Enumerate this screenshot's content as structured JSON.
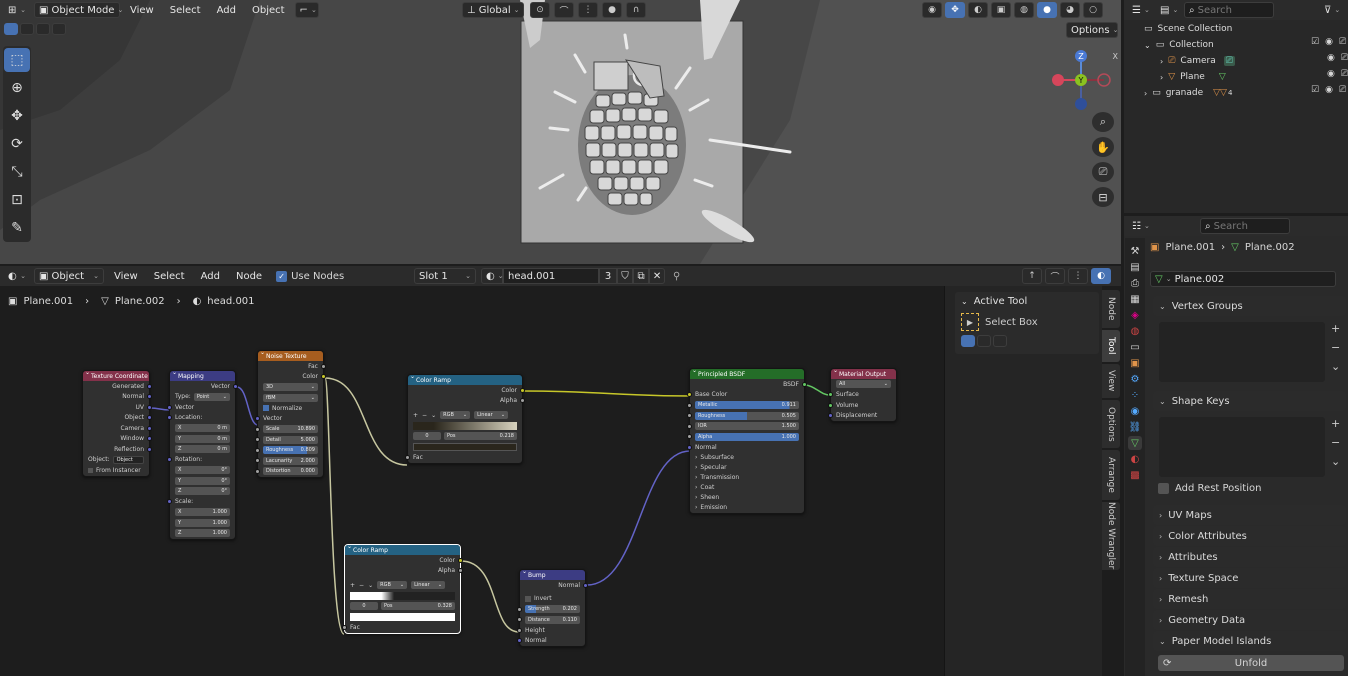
{
  "viewport": {
    "mode": "Object Mode",
    "menus": [
      "View",
      "Select",
      "Add",
      "Object"
    ],
    "orientation": "Global",
    "options": "Options",
    "axis_x": "X",
    "axis_y": "Y",
    "axis_z": "Z"
  },
  "node_editor": {
    "editor": "Object",
    "menus": [
      "View",
      "Select",
      "Add",
      "Node"
    ],
    "use_nodes": "Use Nodes",
    "slot": "Slot 1",
    "material": "head.001",
    "users": "3",
    "breadcrumb": [
      "Plane.001",
      "Plane.002",
      "head.001"
    ],
    "tabs": [
      "Node",
      "Tool",
      "View",
      "Options",
      "Arrange",
      "Node Wrangler"
    ],
    "active_tool": {
      "title": "Active Tool",
      "tool": "Select Box"
    },
    "nodes": {
      "texcoord": {
        "title": "Texture Coordinate",
        "outputs": [
          "Generated",
          "Normal",
          "UV",
          "Object",
          "Camera",
          "Window",
          "Reflection"
        ],
        "object_label": "Object:",
        "object_ph": "Object",
        "instancer": "From Instancer"
      },
      "mapping": {
        "title": "Mapping",
        "out": "Vector",
        "type_label": "Type:",
        "type": "Point",
        "in": "Vector",
        "location": "Location:",
        "rotation": "Rotation:",
        "scale": "Scale:",
        "x": "X",
        "y": "Y",
        "z": "Z",
        "loc": [
          "0 m",
          "0 m",
          "0 m"
        ],
        "rot": [
          "0°",
          "0°",
          "0°"
        ],
        "scl": [
          "1.000",
          "1.000",
          "1.000"
        ]
      },
      "noise": {
        "title": "Noise Texture",
        "fac": "Fac",
        "color": "Color",
        "dim": "3D",
        "basis": "fBM",
        "normalize": "Normalize",
        "vector": "Vector",
        "fields": [
          [
            "Scale",
            "10.890"
          ],
          [
            "Detail",
            "5.000"
          ],
          [
            "Roughness",
            "0.809"
          ],
          [
            "Lacunarity",
            "2.000"
          ],
          [
            "Distortion",
            "0.000"
          ]
        ]
      },
      "ramp1": {
        "title": "Color Ramp",
        "color": "Color",
        "alpha": "Alpha",
        "mode": "RGB",
        "interp": "Linear",
        "index": "0",
        "pos_label": "Pos",
        "pos": "0.218",
        "fac": "Fac"
      },
      "ramp2": {
        "title": "Color Ramp",
        "color": "Color",
        "alpha": "Alpha",
        "mode": "RGB",
        "interp": "Linear",
        "index": "0",
        "pos_label": "Pos",
        "pos": "0.328",
        "fac": "Fac"
      },
      "bump": {
        "title": "Bump",
        "normal_out": "Normal",
        "invert": "Invert",
        "strength_l": "Strength",
        "strength": "0.202",
        "distance_l": "Distance",
        "distance": "0.110",
        "height": "Height",
        "normal_in": "Normal"
      },
      "bsdf": {
        "title": "Principled BSDF",
        "out": "BSDF",
        "base": "Base Color",
        "fields": [
          [
            "Metallic",
            "0.911"
          ],
          [
            "Roughness",
            "0.505"
          ],
          [
            "IOR",
            "1.500"
          ],
          [
            "Alpha",
            "1.000"
          ]
        ],
        "normal": "Normal",
        "panels": [
          "Subsurface",
          "Specular",
          "Transmission",
          "Coat",
          "Sheen",
          "Emission"
        ]
      },
      "output": {
        "title": "Material Output",
        "target": "All",
        "inputs": [
          "Surface",
          "Volume",
          "Displacement"
        ]
      }
    }
  },
  "outliner": {
    "search": "Search",
    "scene": "Scene Collection",
    "collection": "Collection",
    "camera": "Camera",
    "plane": "Plane",
    "granade": "granade",
    "count": "4"
  },
  "properties": {
    "search": "Search",
    "obj": "Plane.001",
    "mesh": "Plane.002",
    "mesh_field": "Plane.002",
    "panels": [
      "Vertex Groups",
      "Shape Keys"
    ],
    "add_rest": "Add Rest Position",
    "collapsed": [
      "UV Maps",
      "Color Attributes",
      "Attributes",
      "Texture Space",
      "Remesh",
      "Geometry Data",
      "Paper Model Islands"
    ],
    "unfold": "Unfold"
  }
}
